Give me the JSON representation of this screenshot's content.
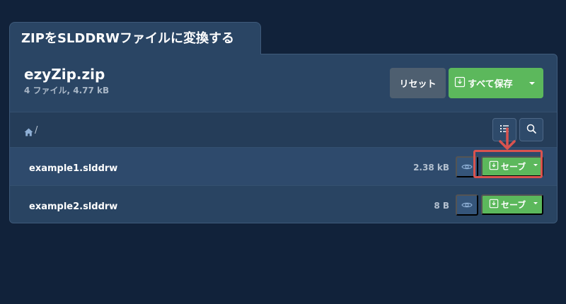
{
  "tab_title": "ZIPをSLDDRWファイルに変換する",
  "archive": {
    "name": "ezyZip.zip",
    "info": "4 ファイル, 4.77 kB"
  },
  "buttons": {
    "reset": "リセット",
    "save_all": "すべて保存"
  },
  "path": {
    "separator": "/"
  },
  "files": [
    {
      "name": "example1.slddrw",
      "size": "2.38 kB",
      "save": "セーブ"
    },
    {
      "name": "example2.slddrw",
      "size": "8 B",
      "save": "セーブ"
    }
  ],
  "colors": {
    "background": "#11223a",
    "panel": "#2a4564",
    "green": "#5cb85c",
    "reset": "#4e5f70",
    "highlight": "#d9534f"
  }
}
